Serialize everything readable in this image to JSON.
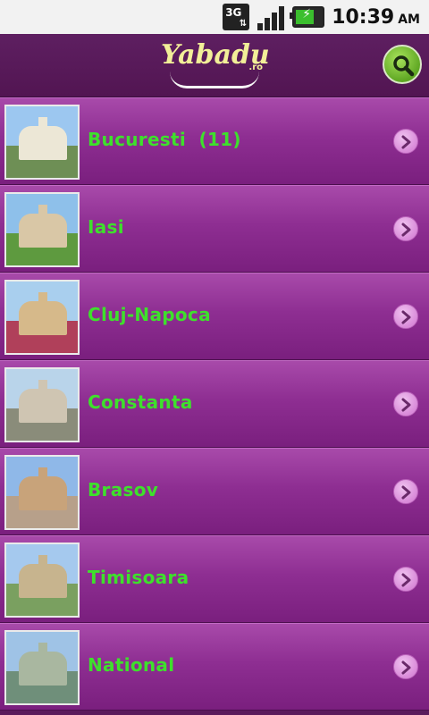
{
  "status_bar": {
    "network_type": "3G",
    "time": "10:39",
    "ampm": "AM",
    "icons": [
      "3g-data-icon",
      "signal-strength-icon",
      "battery-charging-icon"
    ]
  },
  "header": {
    "logo_text": "Yabadu",
    "logo_domain": ".ro",
    "search_icon": "search-icon"
  },
  "cities": [
    {
      "label": "Bucuresti  (11)",
      "thumb_icon": "city-photo"
    },
    {
      "label": "Iasi",
      "thumb_icon": "city-photo"
    },
    {
      "label": "Cluj-Napoca",
      "thumb_icon": "city-photo"
    },
    {
      "label": "Constanta",
      "thumb_icon": "city-photo"
    },
    {
      "label": "Brasov",
      "thumb_icon": "city-photo"
    },
    {
      "label": "Timisoara",
      "thumb_icon": "city-photo"
    },
    {
      "label": "National",
      "thumb_icon": "city-photo"
    }
  ],
  "colors": {
    "accent_green": "#3ee02c",
    "header_purple": "#5a1b5c",
    "row_purple": "#8e2e92"
  }
}
